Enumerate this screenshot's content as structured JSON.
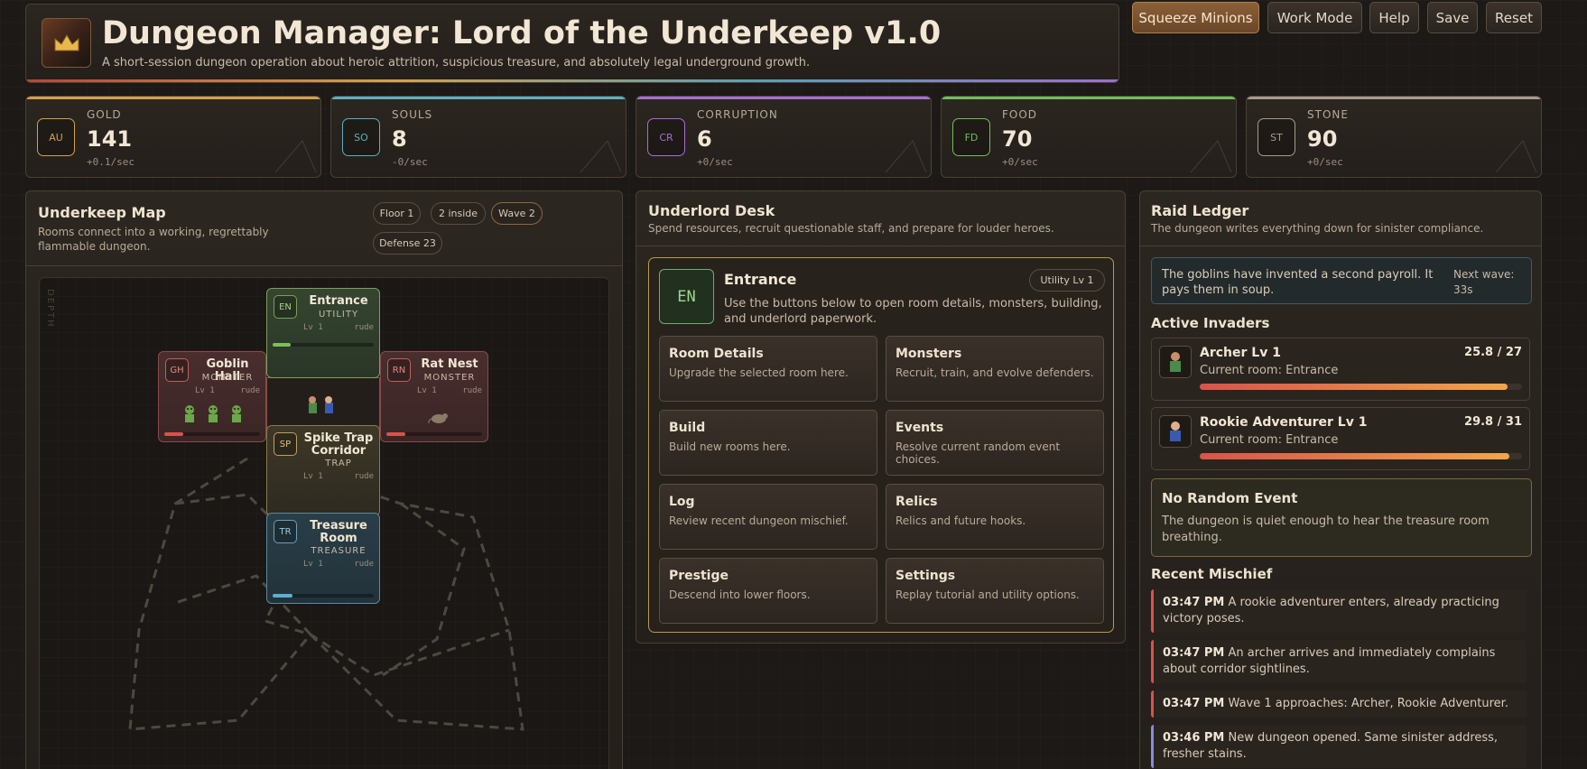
{
  "header": {
    "title": "Dungeon Manager: Lord of the Underkeep v1.0",
    "subtitle": "A short-session dungeon operation about heroic attrition, suspicious treasure, and absolutely legal underground growth."
  },
  "top_buttons": {
    "squeeze": "Squeeze Minions",
    "work_mode": "Work Mode",
    "help": "Help",
    "save": "Save",
    "reset": "Reset"
  },
  "resources": [
    {
      "label": "GOLD",
      "abbr": "AU",
      "value": "141",
      "rate": "+0.1/sec",
      "color": "#d4a04b"
    },
    {
      "label": "SOULS",
      "abbr": "SO",
      "value": "8",
      "rate": "-0/sec",
      "color": "#5ab0c0"
    },
    {
      "label": "CORRUPTION",
      "abbr": "CR",
      "value": "6",
      "rate": "+0/sec",
      "color": "#a66fd6"
    },
    {
      "label": "FOOD",
      "abbr": "FD",
      "value": "70",
      "rate": "+0/sec",
      "color": "#6fbf5a"
    },
    {
      "label": "STONE",
      "abbr": "ST",
      "value": "90",
      "rate": "+0/sec",
      "color": "#a89a8a"
    }
  ],
  "map": {
    "title": "Underkeep Map",
    "subtitle": "Rooms connect into a working, regrettably flammable dungeon.",
    "chips": {
      "floor": "Floor 1",
      "inside": "2 inside",
      "wave": "Wave 2",
      "defense": "Defense 23"
    },
    "depth_label": "DEPTH",
    "rooms": {
      "entrance": {
        "abbr": "EN",
        "name": "Entrance",
        "type": "UTILITY",
        "level": "Lv 1",
        "mood": "rude",
        "fill": 0.18
      },
      "goblin": {
        "abbr": "GH",
        "name": "Goblin Hall",
        "type": "MONSTER",
        "level": "Lv 1",
        "mood": "rude",
        "fill": 0.2
      },
      "rat": {
        "abbr": "RN",
        "name": "Rat Nest",
        "type": "MONSTER",
        "level": "Lv 1",
        "mood": "rude",
        "fill": 0.2
      },
      "spike": {
        "abbr": "SP",
        "name": "Spike Trap Corridor",
        "type": "TRAP",
        "level": "Lv 1",
        "mood": "rude",
        "fill": 0
      },
      "treasure": {
        "abbr": "TR",
        "name": "Treasure Room",
        "type": "TREASURE",
        "level": "Lv 1",
        "mood": "rude",
        "fill": 0.2
      }
    }
  },
  "desk": {
    "title": "Underlord Desk",
    "subtitle": "Spend resources, recruit questionable staff, and prepare for louder heroes.",
    "selected": {
      "abbr": "EN",
      "name": "Entrance",
      "chip": "Utility Lv 1",
      "description": "Use the buttons below to open room details, monsters, building, and underlord paperwork."
    },
    "buttons": [
      {
        "title": "Room Details",
        "desc": "Upgrade the selected room here."
      },
      {
        "title": "Monsters",
        "desc": "Recruit, train, and evolve defenders."
      },
      {
        "title": "Build",
        "desc": "Build new rooms here."
      },
      {
        "title": "Events",
        "desc": "Resolve current random event choices."
      },
      {
        "title": "Log",
        "desc": "Review recent dungeon mischief."
      },
      {
        "title": "Relics",
        "desc": "Relics and future hooks."
      },
      {
        "title": "Prestige",
        "desc": "Descend into lower floors."
      },
      {
        "title": "Settings",
        "desc": "Replay tutorial and utility options."
      }
    ]
  },
  "ledger": {
    "title": "Raid Ledger",
    "subtitle": "The dungeon writes everything down for sinister compliance.",
    "notice": "The goblins have invented a second payroll. It pays them in soup.",
    "next_wave": "Next wave: 33s",
    "invaders_title": "Active Invaders",
    "invaders": [
      {
        "name": "Archer Lv 1",
        "hp": "25.8 / 27",
        "room": "Current room: Entrance",
        "hp_fraction": 0.955
      },
      {
        "name": "Rookie Adventurer Lv 1",
        "hp": "29.8 / 31",
        "room": "Current room: Entrance",
        "hp_fraction": 0.961
      }
    ],
    "event": {
      "title": "No Random Event",
      "desc": "The dungeon is quiet enough to hear the treasure room breathing."
    },
    "mischief_title": "Recent Mischief",
    "logs": [
      {
        "time": "03:47 PM",
        "text": "A rookie adventurer enters, already practicing victory poses.",
        "color": "#d9534a"
      },
      {
        "time": "03:47 PM",
        "text": "An archer arrives and immediately complains about corridor sightlines.",
        "color": "#d9534a"
      },
      {
        "time": "03:47 PM",
        "text": "Wave 1 approaches: Archer, Rookie Adventurer.",
        "color": "#d9534a"
      },
      {
        "time": "03:46 PM",
        "text": "New dungeon opened. Same sinister address, fresher stains.",
        "color": "#8a8ae0"
      }
    ]
  }
}
